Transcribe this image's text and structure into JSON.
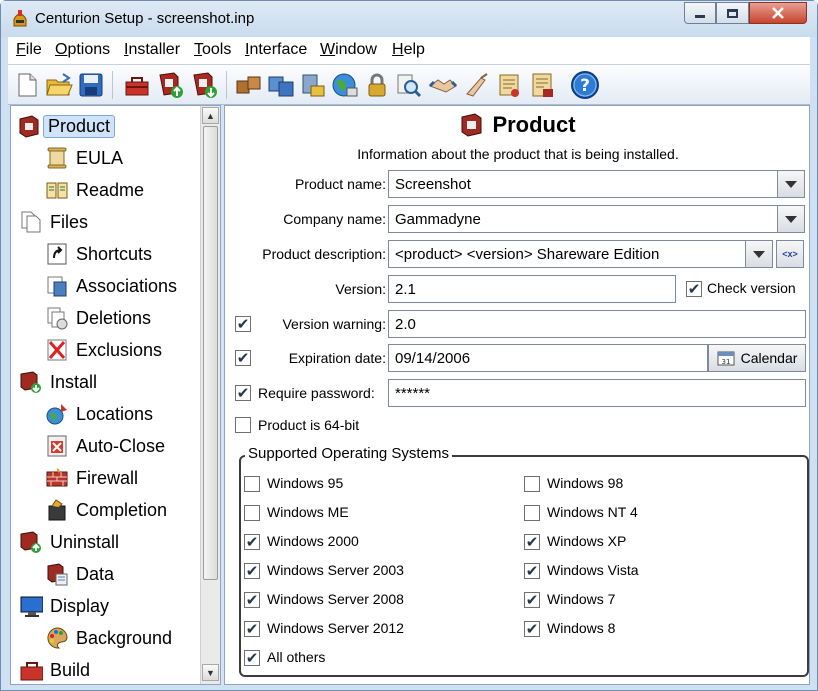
{
  "window": {
    "title": "Centurion Setup - screenshot.inp",
    "controls": {
      "minimize": "minimize-icon",
      "maximize": "maximize-icon",
      "close": "close-icon"
    }
  },
  "menu": [
    {
      "label": "File",
      "accel": "F",
      "rest": "ile"
    },
    {
      "label": "Options",
      "accel": "O",
      "rest": "ptions"
    },
    {
      "label": "Installer",
      "accel": "I",
      "rest": "nstaller"
    },
    {
      "label": "Tools",
      "accel": "T",
      "rest": "ools"
    },
    {
      "label": "Interface",
      "accel": "I",
      "rest": "nterface"
    },
    {
      "label": "Window",
      "accel": "W",
      "rest": "indow"
    },
    {
      "label": "Help",
      "accel": "H",
      "rest": "elp"
    }
  ],
  "toolbar": [
    "new-file-icon",
    "open-folder-icon",
    "save-icon",
    "toolbox-icon",
    "upload-icon",
    "download-icon",
    "packages-icon",
    "disk-icon",
    "install-icon",
    "globe-icon",
    "lock-icon",
    "search-icon",
    "handshake-icon",
    "pointer-icon",
    "scroll-icon",
    "certificate-icon",
    "help-icon"
  ],
  "tree": {
    "items": [
      {
        "label": "Product",
        "icon": "product-box-icon",
        "level": 0,
        "selected": true
      },
      {
        "label": "EULA",
        "icon": "scroll-icon",
        "level": 1
      },
      {
        "label": "Readme",
        "icon": "book-icon",
        "level": 1
      },
      {
        "label": "Files",
        "icon": "files-icon",
        "level": 0
      },
      {
        "label": "Shortcuts",
        "icon": "shortcut-icon",
        "level": 1
      },
      {
        "label": "Associations",
        "icon": "association-icon",
        "level": 1
      },
      {
        "label": "Deletions",
        "icon": "deletions-icon",
        "level": 1
      },
      {
        "label": "Exclusions",
        "icon": "exclusion-icon",
        "level": 1
      },
      {
        "label": "Install",
        "icon": "install-icon",
        "level": 0
      },
      {
        "label": "Locations",
        "icon": "location-icon",
        "level": 1
      },
      {
        "label": "Auto-Close",
        "icon": "autoclose-icon",
        "level": 1
      },
      {
        "label": "Firewall",
        "icon": "firewall-icon",
        "level": 1
      },
      {
        "label": "Completion",
        "icon": "completion-icon",
        "level": 1
      },
      {
        "label": "Uninstall",
        "icon": "uninstall-icon",
        "level": 0
      },
      {
        "label": "Data",
        "icon": "data-icon",
        "level": 1
      },
      {
        "label": "Display",
        "icon": "monitor-icon",
        "level": 0
      },
      {
        "label": "Background",
        "icon": "palette-icon",
        "level": 1
      },
      {
        "label": "Build",
        "icon": "build-icon",
        "level": 0
      }
    ]
  },
  "panel": {
    "title": "Product",
    "subtitle": "Information about the product that is being installed.",
    "product_name": {
      "label": "Product name:",
      "value": "Screenshot"
    },
    "company_name": {
      "label": "Company name:",
      "value": "Gammadyne"
    },
    "product_description": {
      "label": "Product description:",
      "value": "<product> <version> Shareware Edition",
      "tag_button": "<x>"
    },
    "version": {
      "label": "Version:",
      "value": "2.1"
    },
    "check_version": {
      "label": "Check version",
      "checked": true
    },
    "version_warning": {
      "label": "Version warning:",
      "value": "2.0",
      "checked": true
    },
    "expiration_date": {
      "label": "Expiration date:",
      "value": "09/14/2006",
      "checked": true,
      "calendar_label": "Calendar"
    },
    "require_password": {
      "label": "Require password:",
      "value": "******",
      "checked": true
    },
    "product_64bit": {
      "label": "Product is 64-bit",
      "checked": false
    },
    "os_group": {
      "title": "Supported Operating Systems",
      "left": [
        {
          "label": "Windows 95",
          "checked": false
        },
        {
          "label": "Windows ME",
          "checked": false
        },
        {
          "label": "Windows 2000",
          "checked": true
        },
        {
          "label": "Windows Server 2003",
          "checked": true
        },
        {
          "label": "Windows Server 2008",
          "checked": true
        },
        {
          "label": "Windows Server 2012",
          "checked": true
        },
        {
          "label": "All others",
          "checked": true
        }
      ],
      "right": [
        {
          "label": "Windows 98",
          "checked": false
        },
        {
          "label": "Windows NT 4",
          "checked": false
        },
        {
          "label": "Windows XP",
          "checked": true
        },
        {
          "label": "Windows Vista",
          "checked": true
        },
        {
          "label": "Windows 7",
          "checked": true
        },
        {
          "label": "Windows 8",
          "checked": true
        }
      ]
    }
  },
  "colors": {
    "window_frame": "#cfe0f2",
    "selection": "#cfe3fb",
    "close_button": "#c7442d"
  }
}
